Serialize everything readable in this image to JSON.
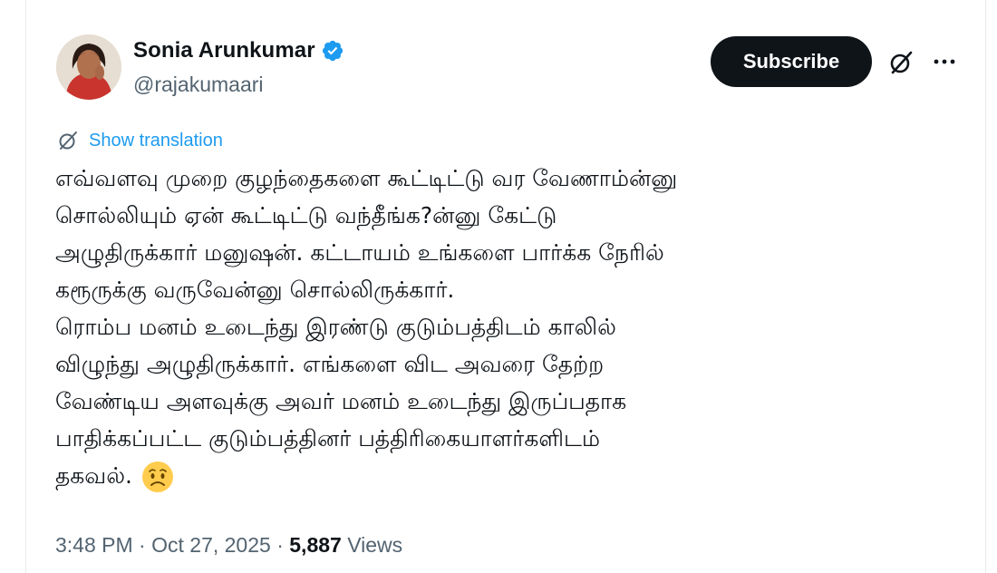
{
  "author": {
    "display_name": "Sonia Arunkumar",
    "handle": "@rajakumaari",
    "verified": true
  },
  "actions": {
    "subscribe_label": "Subscribe",
    "grok_icon": "grok-icon",
    "more_icon": "more-icon"
  },
  "translate": {
    "label": "Show translation",
    "icon": "grok-icon"
  },
  "tweet": {
    "lines": [
      "எவ்வளவு முறை குழந்தைகளை கூட்டிட்டு வர வேணாம்ன்னு",
      "சொல்லியும் ஏன் கூட்டிட்டு வந்தீங்க?ன்னு கேட்டு",
      "அழுதிருக்கார் மனுஷன். கட்டாயம் உங்களை பார்க்க நேரில்",
      "கரூருக்கு வருவேன்னு சொல்லிருக்கார்.",
      "ரொம்ப மனம் உடைந்து இரண்டு குடும்பத்திடம் காலில்",
      "விழுந்து அழுதிருக்கார். எங்களை விட அவரை தேற்ற",
      "வேண்டிய அளவுக்கு அவர் மனம் உடைந்து இருப்பதாக",
      "பாதிக்கப்பட்ட குடும்பத்தினர் பத்திரிகையாளர்களிடம்",
      "தகவல்."
    ],
    "emoji": "worried-face-emoji"
  },
  "meta": {
    "time": "3:48 PM",
    "separator": "·",
    "date": "Oct 27, 2025",
    "views_count": "5,887",
    "views_label": "Views"
  },
  "colors": {
    "accent": "#1d9bf0",
    "text": "#0f1419",
    "secondary": "#536471",
    "button_bg": "#0f1419"
  }
}
